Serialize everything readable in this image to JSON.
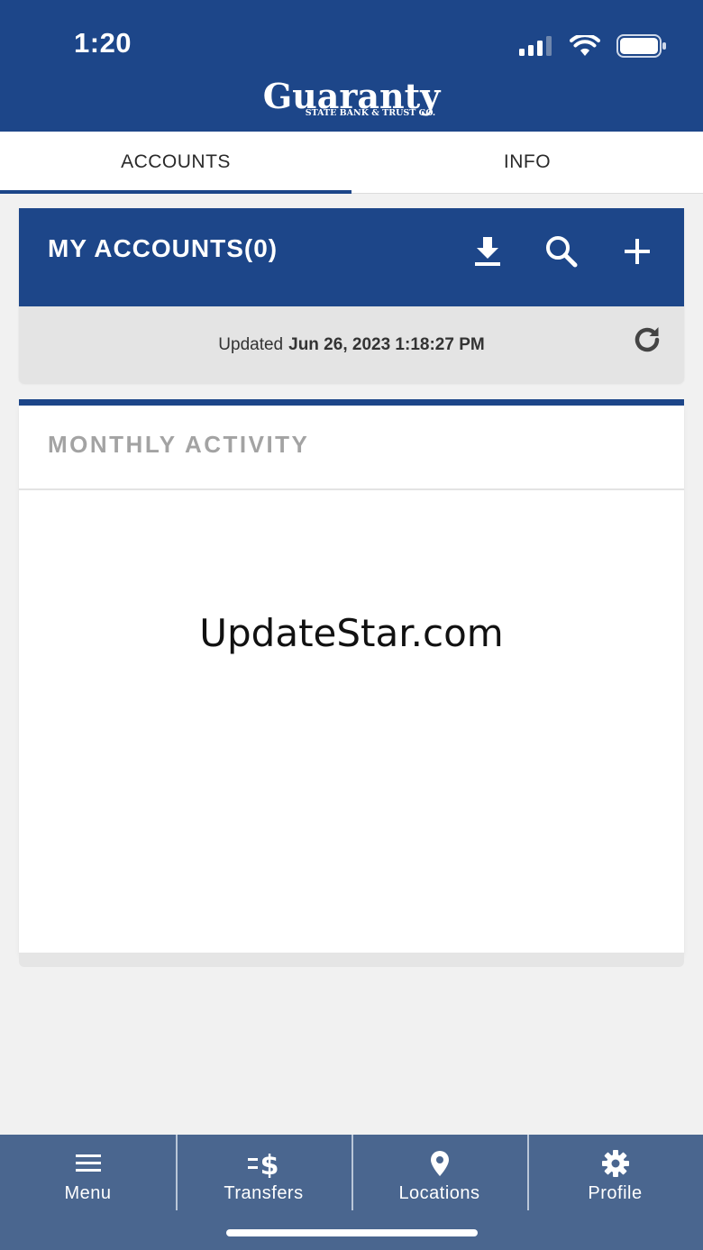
{
  "status_bar": {
    "time": "1:20"
  },
  "brand": {
    "name": "Guaranty",
    "tagline": "STATE BANK & TRUST CO."
  },
  "tabs": [
    {
      "label": "ACCOUNTS",
      "active": true
    },
    {
      "label": "INFO",
      "active": false
    }
  ],
  "accounts": {
    "title": "MY ACCOUNTS(0)",
    "updated_prefix": "Updated",
    "updated_value": "Jun 26, 2023 1:18:27 PM"
  },
  "activity": {
    "title": "MONTHLY ACTIVITY"
  },
  "watermark": "UpdateStar.com",
  "bottom_nav": [
    {
      "label": "Menu",
      "icon": "menu-icon"
    },
    {
      "label": "Transfers",
      "icon": "transfers-icon"
    },
    {
      "label": "Locations",
      "icon": "location-pin-icon"
    },
    {
      "label": "Profile",
      "icon": "gear-icon"
    }
  ],
  "colors": {
    "brand_blue": "#1d4689",
    "nav_blue": "#4a668f",
    "background": "#f1f1f1"
  }
}
